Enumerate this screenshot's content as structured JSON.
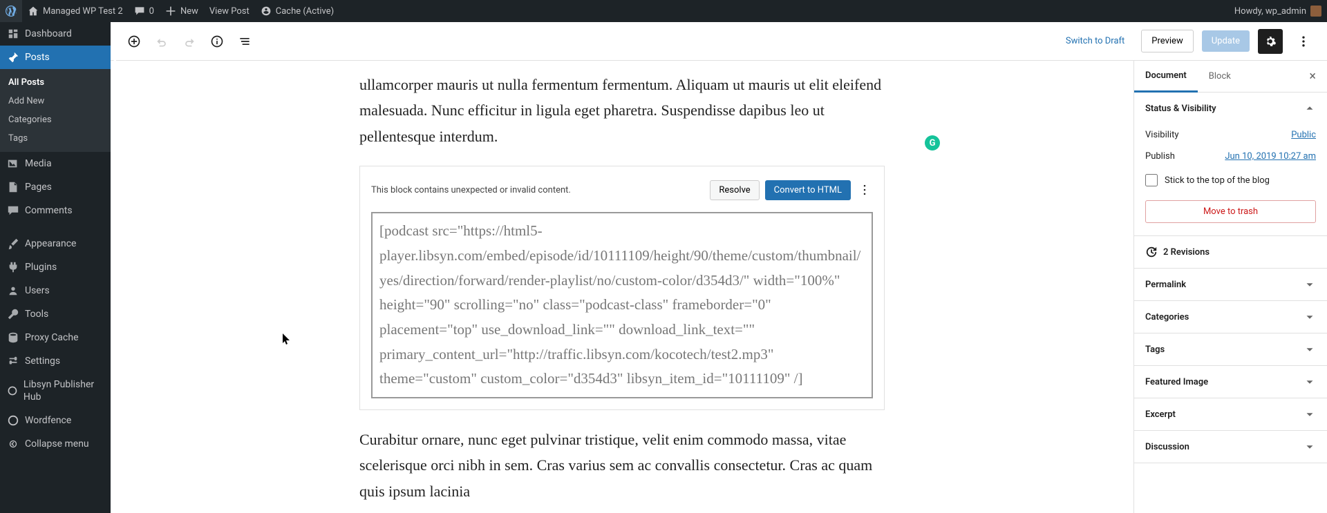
{
  "adminbar": {
    "site_name": "Managed WP Test 2",
    "comments_count": "0",
    "new_label": "New",
    "view_post_label": "View Post",
    "cache_label": "Cache (Active)",
    "howdy": "Howdy, wp_admin"
  },
  "sidebar": {
    "dashboard": "Dashboard",
    "posts": "Posts",
    "all_posts": "All Posts",
    "add_new": "Add New",
    "categories": "Categories",
    "tags": "Tags",
    "media": "Media",
    "pages": "Pages",
    "comments": "Comments",
    "appearance": "Appearance",
    "plugins": "Plugins",
    "users": "Users",
    "tools": "Tools",
    "proxy_cache": "Proxy Cache",
    "settings": "Settings",
    "libsyn": "Libsyn Publisher Hub",
    "wordfence": "Wordfence",
    "collapse": "Collapse menu"
  },
  "toolbar": {
    "switch_to_draft": "Switch to Draft",
    "preview": "Preview",
    "update": "Update"
  },
  "content": {
    "para1": "ullamcorper mauris ut nulla fermentum fermentum. Aliquam ut mauris ut elit eleifend malesuada. Nunc efficitur in ligula eget pharetra. Suspendisse dapibus leo ut pellentesque interdum.",
    "warning_msg": "This block contains unexpected or invalid content.",
    "resolve": "Resolve",
    "convert": "Convert to HTML",
    "code": "[podcast src=\"https://html5-player.libsyn.com/embed/episode/id/10111109/height/90/theme/custom/thumbnail/yes/direction/forward/render-playlist/no/custom-color/d354d3/\" width=\"100%\" height=\"90\" scrolling=\"no\" class=\"podcast-class\" frameborder=\"0\" placement=\"top\" use_download_link=\"\" download_link_text=\"\" primary_content_url=\"http://traffic.libsyn.com/kocotech/test2.mp3\" theme=\"custom\" custom_color=\"d354d3\" libsyn_item_id=\"10111109\" /]",
    "para2": "Curabitur ornare, nunc eget pulvinar tristique, velit enim commodo massa, vitae scelerisque orci nibh in sem. Cras varius sem ac convallis consectetur. Cras ac quam quis ipsum lacinia"
  },
  "inspector": {
    "tab_document": "Document",
    "tab_block": "Block",
    "status_visibility": "Status & Visibility",
    "visibility_label": "Visibility",
    "visibility_value": "Public",
    "publish_label": "Publish",
    "publish_value": "Jun 10, 2019 10:27 am",
    "stick_label": "Stick to the top of the blog",
    "move_to_trash": "Move to trash",
    "revisions": "2 Revisions",
    "permalink": "Permalink",
    "categories": "Categories",
    "tags": "Tags",
    "featured_image": "Featured Image",
    "excerpt": "Excerpt",
    "discussion": "Discussion"
  }
}
